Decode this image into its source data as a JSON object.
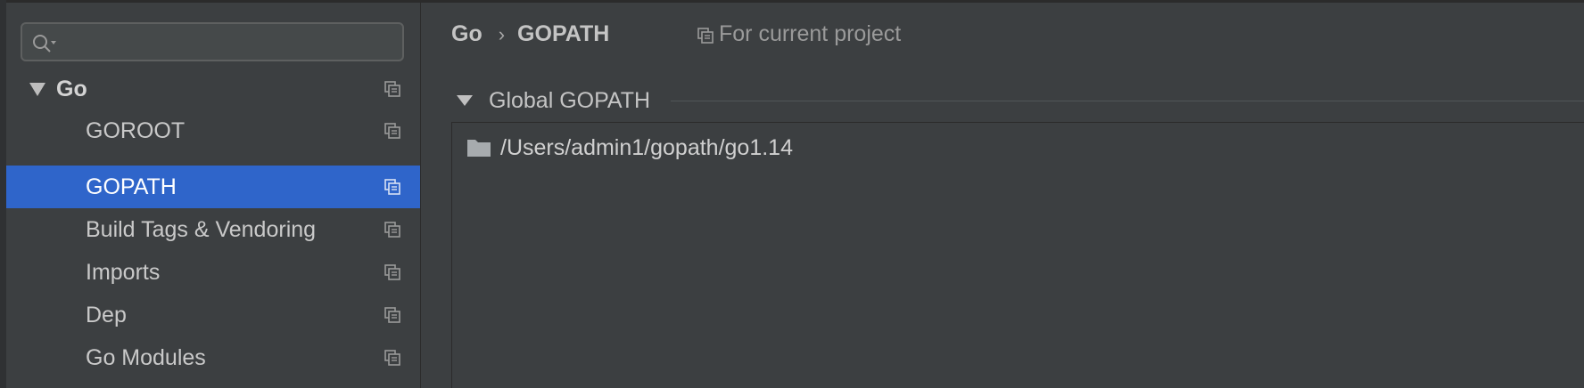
{
  "search": {
    "value": "",
    "placeholder": ""
  },
  "tree": {
    "items": [
      {
        "label": "Go",
        "root": true,
        "selected": false
      },
      {
        "label": "GOROOT",
        "root": false,
        "selected": false
      },
      {
        "label": "GOPATH",
        "root": false,
        "selected": true
      },
      {
        "label": "Build Tags & Vendoring",
        "root": false,
        "selected": false
      },
      {
        "label": "Imports",
        "root": false,
        "selected": false
      },
      {
        "label": "Dep",
        "root": false,
        "selected": false
      },
      {
        "label": "Go Modules",
        "root": false,
        "selected": false
      }
    ]
  },
  "breadcrumb": {
    "parent": "Go",
    "separator": "›",
    "current": "GOPATH"
  },
  "scope_note": "For current project",
  "section": {
    "title": "Global GOPATH"
  },
  "paths": [
    {
      "value": "/Users/admin1/gopath/go1.14"
    }
  ],
  "icons": {
    "search": "search-icon",
    "project": "project-scope-icon",
    "folder": "folder-icon"
  },
  "colors": {
    "selection": "#2f65ca",
    "background": "#3c3f41",
    "text": "#bbbbbb"
  }
}
